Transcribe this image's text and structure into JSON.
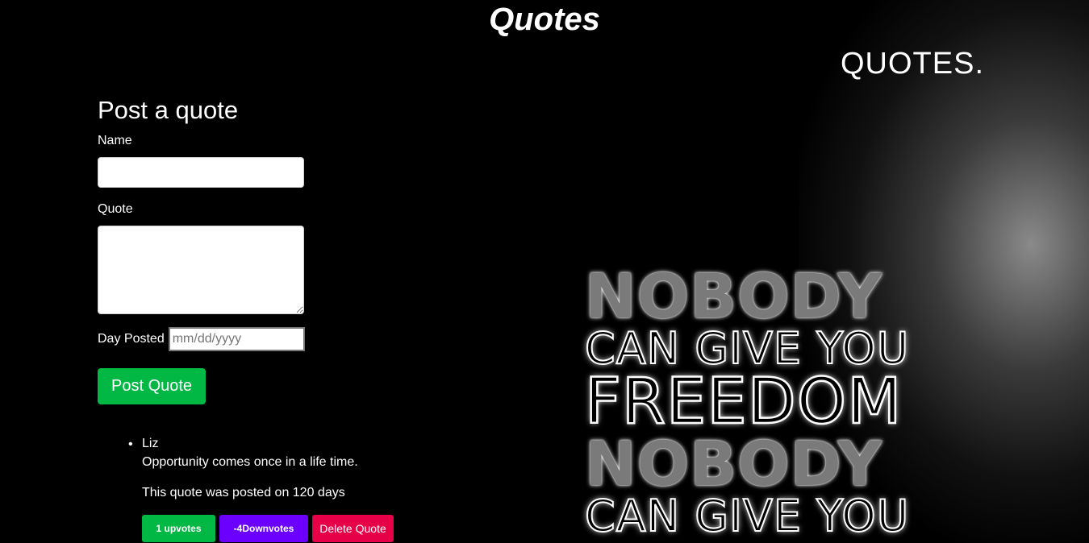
{
  "header": {
    "title": "Quotes",
    "brand": "QUOTES."
  },
  "poster": {
    "line1": "NOBODY",
    "line2": "CAN GIVE YOU",
    "line3": "FREEDOM",
    "line4": "NOBODY",
    "line5": "CAN GIVE YOU"
  },
  "form": {
    "heading": "Post a quote",
    "name_label": "Name",
    "name_value": "",
    "quote_label": "Quote",
    "quote_value": "",
    "date_label": "Day Posted",
    "date_placeholder": "mm/dd/yyyy",
    "submit_label": "Post Quote"
  },
  "quotes": [
    {
      "author": "Liz",
      "text": "Opportunity comes once in a life time.",
      "posted": "This quote was posted on 120 days",
      "upvote_label": "1 upvotes",
      "downvote_label": "-4Downvotes",
      "delete_label": "Delete Quote"
    }
  ]
}
